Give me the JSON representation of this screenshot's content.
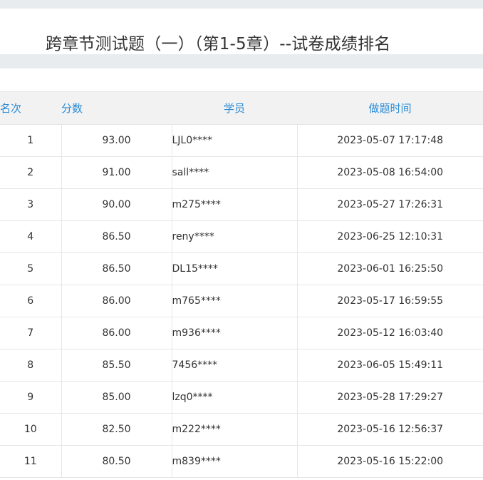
{
  "page_title": "跨章节测试题（一）（第1-5章）--试卷成绩排名",
  "table": {
    "headers": {
      "rank": "名次",
      "score": "分数",
      "student": "学员",
      "time": "做题时间"
    },
    "rows": [
      {
        "rank": "1",
        "score": "93.00",
        "student": "LJL0****",
        "time": "2023-05-07 17:17:48"
      },
      {
        "rank": "2",
        "score": "91.00",
        "student": "sall****",
        "time": "2023-05-08 16:54:00"
      },
      {
        "rank": "3",
        "score": "90.00",
        "student": "m275****",
        "time": "2023-05-27 17:26:31"
      },
      {
        "rank": "4",
        "score": "86.50",
        "student": "reny****",
        "time": "2023-06-25 12:10:31"
      },
      {
        "rank": "5",
        "score": "86.50",
        "student": "DL15****",
        "time": "2023-06-01 16:25:50"
      },
      {
        "rank": "6",
        "score": "86.00",
        "student": "m765****",
        "time": "2023-05-17 16:59:55"
      },
      {
        "rank": "7",
        "score": "86.00",
        "student": "m936****",
        "time": "2023-05-12 16:03:40"
      },
      {
        "rank": "8",
        "score": "85.50",
        "student": "7456****",
        "time": "2023-06-05 15:49:11"
      },
      {
        "rank": "9",
        "score": "85.00",
        "student": "lzq0****",
        "time": "2023-05-28 17:29:27"
      },
      {
        "rank": "10",
        "score": "82.50",
        "student": "m222****",
        "time": "2023-05-16 12:56:37"
      },
      {
        "rank": "11",
        "score": "80.50",
        "student": "m839****",
        "time": "2023-05-16 15:22:00"
      }
    ]
  },
  "colors": {
    "header_text": "#2a8bd6",
    "header_bg": "#f2f2f2",
    "page_bg": "#e9ecef"
  }
}
